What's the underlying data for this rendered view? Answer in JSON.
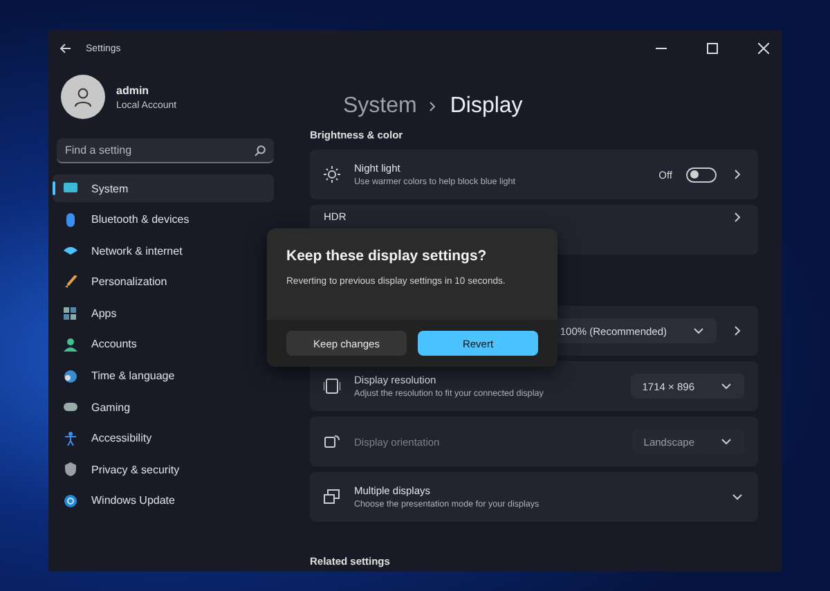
{
  "window": {
    "title": "Settings"
  },
  "account": {
    "name": "admin",
    "type": "Local Account"
  },
  "search": {
    "placeholder": "Find a setting"
  },
  "sidebar": {
    "items": [
      {
        "label": "System",
        "selected": true
      },
      {
        "label": "Bluetooth & devices",
        "selected": false
      },
      {
        "label": "Network & internet",
        "selected": false
      },
      {
        "label": "Personalization",
        "selected": false
      },
      {
        "label": "Apps",
        "selected": false
      },
      {
        "label": "Accounts",
        "selected": false
      },
      {
        "label": "Time & language",
        "selected": false
      },
      {
        "label": "Gaming",
        "selected": false
      },
      {
        "label": "Accessibility",
        "selected": false
      },
      {
        "label": "Privacy & security",
        "selected": false
      },
      {
        "label": "Windows Update",
        "selected": false
      }
    ]
  },
  "breadcrumb": {
    "parent": "System",
    "current": "Display"
  },
  "section_title": "Brightness & color",
  "rows": [
    {
      "kind": "toggle",
      "title": "Night light",
      "subtitle": "Use warmer colors to help block blue light",
      "state_label": "Off",
      "on": false,
      "disabled": false
    },
    {
      "kind": "link",
      "title": "HDR",
      "disabled": false
    },
    {
      "kind": "spacer"
    },
    {
      "kind": "dropdown",
      "value": "100% (Recommended)",
      "chevron": true,
      "disabled": false
    },
    {
      "kind": "dropdown",
      "title": "Display resolution",
      "subtitle": "Adjust the resolution to fit your connected display",
      "value": "1714 × 896",
      "chevron": false,
      "disabled": false
    },
    {
      "kind": "dropdown",
      "title": "Display orientation",
      "value": "Landscape",
      "chevron": false,
      "disabled": true
    },
    {
      "kind": "expand",
      "title": "Multiple displays",
      "subtitle": "Choose the presentation mode for your displays",
      "disabled": false
    }
  ],
  "footer_title": "Related settings",
  "dialog": {
    "title": "Keep these display settings?",
    "message": "Reverting to previous display settings in 10 seconds.",
    "buttons": [
      {
        "label": "Keep changes",
        "kind": "secondary"
      },
      {
        "label": "Revert",
        "kind": "primary"
      }
    ]
  }
}
